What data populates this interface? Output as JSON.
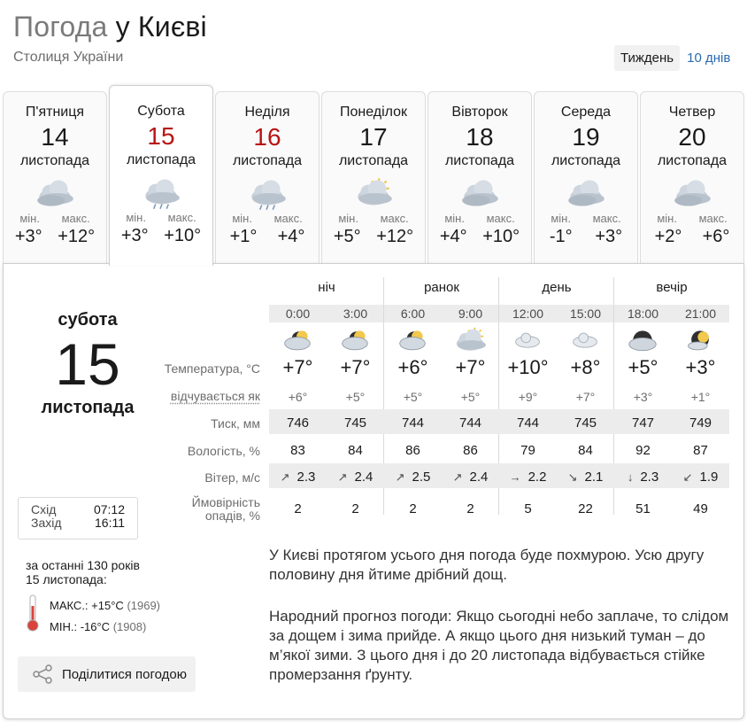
{
  "header": {
    "title_prefix": "Погода",
    "title_city": "у Києві",
    "subtitle": "Столиця України",
    "switch_week": "Тиждень",
    "switch_10days": "10 днів"
  },
  "colors": {
    "accent_link": "#2a6ab0",
    "weekend_red": "#b81414"
  },
  "days": [
    {
      "dow": "П'ятниця",
      "day": "14",
      "month": "листопада",
      "icon": "cloudy-icon",
      "min_label": "мін.",
      "max_label": "макс.",
      "min": "+3°",
      "max": "+12°"
    },
    {
      "dow": "Субота",
      "day": "15",
      "month": "листопада",
      "icon": "cloud-light-rain-icon",
      "min_label": "мін.",
      "max_label": "макс.",
      "min": "+3°",
      "max": "+10°"
    },
    {
      "dow": "Неділя",
      "day": "16",
      "month": "листопада",
      "icon": "cloud-light-rain-icon",
      "min_label": "мін.",
      "max_label": "макс.",
      "min": "+1°",
      "max": "+4°"
    },
    {
      "dow": "Понеділок",
      "day": "17",
      "month": "листопада",
      "icon": "partly-sunny-icon",
      "min_label": "мін.",
      "max_label": "макс.",
      "min": "+5°",
      "max": "+12°"
    },
    {
      "dow": "Вівторок",
      "day": "18",
      "month": "листопада",
      "icon": "cloudy-icon",
      "min_label": "мін.",
      "max_label": "макс.",
      "min": "+4°",
      "max": "+10°"
    },
    {
      "dow": "Середа",
      "day": "19",
      "month": "листопада",
      "icon": "cloudy-icon",
      "min_label": "мін.",
      "max_label": "макс.",
      "min": "-1°",
      "max": "+3°"
    },
    {
      "dow": "Четвер",
      "day": "20",
      "month": "листопада",
      "icon": "cloudy-icon",
      "min_label": "мін.",
      "max_label": "макс.",
      "min": "+2°",
      "max": "+6°"
    }
  ],
  "selected": {
    "dow": "субота",
    "day": "15",
    "month": "листопада",
    "sunrise_label": "Схід",
    "sunrise": "07:12",
    "sunset_label": "Захід",
    "sunset": "16:11",
    "history_line1": "за останні 130 років",
    "history_line2": "15 листопада:",
    "max_label": "МАКС.:",
    "max_value": "+15°C",
    "max_year": "(1969)",
    "min_label": "МІН.:",
    "min_value": "-16°C",
    "min_year": "(1908)",
    "share": "Поділитися погодою"
  },
  "hourly": {
    "periods": [
      "ніч",
      "ранок",
      "день",
      "вечір"
    ],
    "times": [
      "0:00",
      "3:00",
      "6:00",
      "9:00",
      "12:00",
      "15:00",
      "18:00",
      "21:00"
    ],
    "icons": [
      "night-cloudy-icon",
      "night-cloudy-icon",
      "night-cloudy-icon",
      "partly-sunny-icon",
      "cloud-icon",
      "cloud-icon",
      "night-overcast-icon",
      "night-partly-cloudy-icon"
    ],
    "labels": {
      "temp": "Температура, °C",
      "feels": "відчувається як",
      "pressure": "Тиск, мм",
      "humidity": "Вологість, %",
      "wind": "Вітер, м/с",
      "precip_1": "Ймовірність",
      "precip_2": "опадів, %"
    },
    "temp": [
      "+7°",
      "+7°",
      "+6°",
      "+7°",
      "+10°",
      "+8°",
      "+5°",
      "+3°"
    ],
    "feels": [
      "+6°",
      "+5°",
      "+5°",
      "+5°",
      "+9°",
      "+7°",
      "+3°",
      "+1°"
    ],
    "pressure": [
      "746",
      "745",
      "744",
      "744",
      "744",
      "745",
      "747",
      "749"
    ],
    "humidity": [
      "83",
      "84",
      "86",
      "86",
      "79",
      "84",
      "92",
      "87"
    ],
    "wind_dir": [
      "↗",
      "↗",
      "↗",
      "↗",
      "→",
      "↘",
      "↓",
      "↙"
    ],
    "wind": [
      "2.3",
      "2.4",
      "2.5",
      "2.4",
      "2.2",
      "2.1",
      "2.3",
      "1.9"
    ],
    "precip": [
      "2",
      "2",
      "2",
      "2",
      "5",
      "22",
      "51",
      "49"
    ]
  },
  "description": "У Києві протягом усього дня погода буде похмурою. Усю другу половину дня йтиме дрібний дощ.",
  "folk": {
    "label": "Народний прогноз погоди:",
    "text": " Якщо сьогодні небо заплаче, то слідом за дощем і зима прийде. А якщо цього дня низький туман – до м’якої зими. З цього дня і до 20 листопада відбувається стійке промерзання ґрунту."
  }
}
